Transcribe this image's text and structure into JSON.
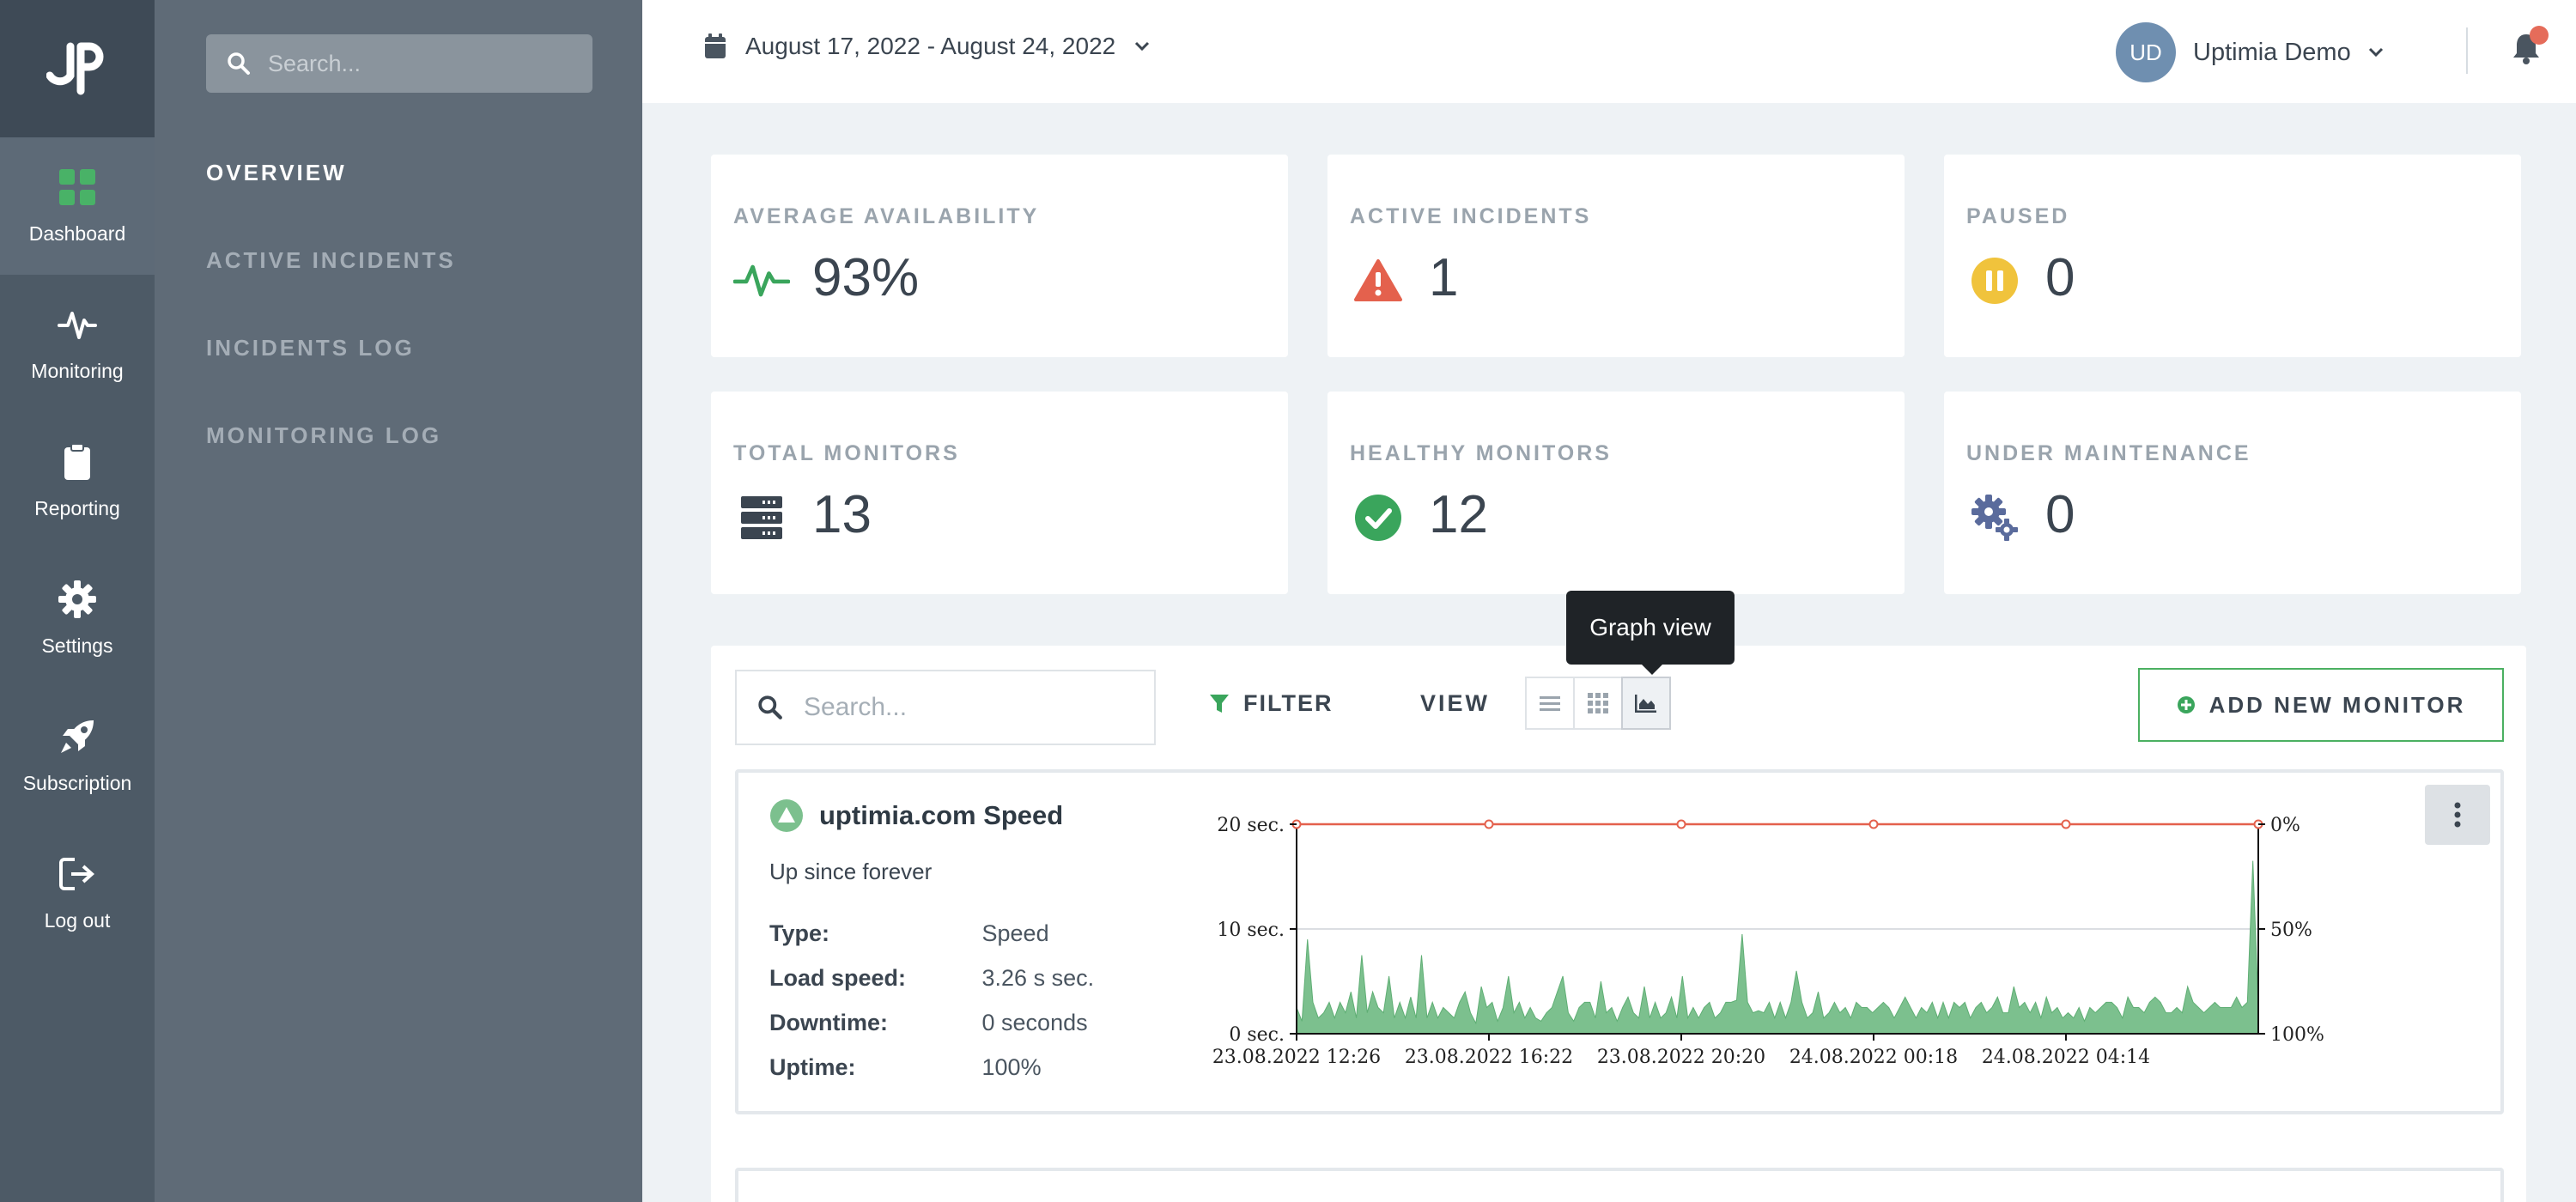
{
  "rail": {
    "items": [
      {
        "label": "Dashboard",
        "icon": "dashboard-icon",
        "active": true
      },
      {
        "label": "Monitoring",
        "icon": "pulse-icon"
      },
      {
        "label": "Reporting",
        "icon": "clipboard-icon"
      },
      {
        "label": "Settings",
        "icon": "gear-icon"
      },
      {
        "label": "Subscription",
        "icon": "rocket-icon"
      },
      {
        "label": "Log out",
        "icon": "logout-icon"
      }
    ]
  },
  "subnav": {
    "search_placeholder": "Search...",
    "items": [
      "OVERVIEW",
      "ACTIVE INCIDENTS",
      "INCIDENTS LOG",
      "MONITORING LOG"
    ]
  },
  "header": {
    "date_range": "August 17, 2022 - August 24, 2022",
    "avatar_initials": "UD",
    "user_name": "Uptimia Demo"
  },
  "stats": [
    {
      "label": "AVERAGE AVAILABILITY",
      "value": "93%",
      "icon": "pulse-icon",
      "color": "#3aa55c"
    },
    {
      "label": "ACTIVE INCIDENTS",
      "value": "1",
      "icon": "warning-icon",
      "color": "#e4614d"
    },
    {
      "label": "PAUSED",
      "value": "0",
      "icon": "pause-icon",
      "color": "#f0c33c"
    },
    {
      "label": "TOTAL MONITORS",
      "value": "13",
      "icon": "server-icon",
      "color": "#3b4550"
    },
    {
      "label": "HEALTHY MONITORS",
      "value": "12",
      "icon": "check-circle-icon",
      "color": "#3aa55c"
    },
    {
      "label": "UNDER MAINTENANCE",
      "value": "0",
      "icon": "gears-icon",
      "color": "#5a6b9c"
    }
  ],
  "toolbar": {
    "search_placeholder": "Search...",
    "filter_label": "FILTER",
    "view_label": "VIEW",
    "tooltip": "Graph view",
    "add_label": "ADD NEW MONITOR"
  },
  "monitor": {
    "name": "uptimia.com Speed",
    "status": "Up since forever",
    "fields": [
      {
        "key": "Type:",
        "value": "Speed"
      },
      {
        "key": "Load speed:",
        "value": "3.26 s sec."
      },
      {
        "key": "Downtime:",
        "value": "0 seconds"
      },
      {
        "key": "Uptime:",
        "value": "100%"
      }
    ]
  },
  "chart_data": {
    "type": "area",
    "x_tick_labels": [
      "23.08.2022 12:26",
      "23.08.2022 16:22",
      "23.08.2022 20:20",
      "24.08.2022 00:18",
      "24.08.2022 04:14"
    ],
    "y_left_ticks": [
      "0 sec.",
      "10 sec.",
      "20 sec."
    ],
    "y_right_ticks": [
      "0%",
      "50%",
      "100%"
    ],
    "ylim_left": [
      0,
      20
    ],
    "series": [
      {
        "color": "#7cc08e",
        "axis": "left",
        "values": [
          2.5,
          1.2,
          9,
          3,
          1.5,
          2,
          3,
          1.5,
          3,
          2,
          4,
          1.5,
          7.5,
          2,
          4,
          2.5,
          2,
          5.5,
          1.5,
          3,
          1.5,
          3.5,
          1.5,
          7.5,
          1.5,
          3,
          1.5,
          2.5,
          2,
          1.5,
          3,
          4,
          2,
          1,
          4.5,
          2.5,
          3,
          1.2,
          2.5,
          5.5,
          2,
          3,
          1.5,
          2.5,
          1.5,
          1.2,
          2,
          2.5,
          4,
          5.5,
          2,
          1.2,
          2.5,
          3,
          3,
          1.5,
          5,
          2,
          2.5,
          1.2,
          2.5,
          3.5,
          2,
          1.5,
          4.5,
          1.5,
          3,
          1.5,
          2,
          3.5,
          1.5,
          5.5,
          1.5,
          2.5,
          1.5,
          2.5,
          3,
          1.5,
          2,
          3,
          3,
          3.2,
          9.5,
          3,
          2,
          2.2,
          2,
          3,
          1.5,
          3,
          1.5,
          3,
          6,
          3,
          1.5,
          2,
          4,
          1.5,
          2,
          3,
          2,
          2.5,
          1.5,
          3,
          2.5,
          2.5,
          2,
          2.5,
          3,
          2.5,
          1.5,
          2.5,
          3.5,
          2.5,
          1.5,
          2.5,
          2,
          3,
          1.5,
          3,
          1.5,
          3,
          2.5,
          3,
          1.5,
          2.5,
          3,
          2,
          2.5,
          3.5,
          2,
          2,
          4.5,
          2.5,
          3,
          2,
          3,
          1.5,
          3.5,
          2,
          2.5,
          1.5,
          2,
          1.5,
          2.5,
          1.2,
          2.5,
          2,
          2.5,
          3,
          3,
          2.5,
          1.5,
          3.5,
          2.5,
          2.5,
          2,
          3,
          3.5,
          3,
          2,
          2,
          2.5,
          2,
          4.5,
          3,
          2.5,
          2,
          2.5,
          3,
          2.5,
          2.5,
          2.5,
          3.5,
          2.5,
          3,
          16.5,
          2.5
        ]
      },
      {
        "color": "#e4614d",
        "axis": "right",
        "values": [
          0,
          0,
          0,
          0,
          0,
          0
        ]
      }
    ]
  }
}
